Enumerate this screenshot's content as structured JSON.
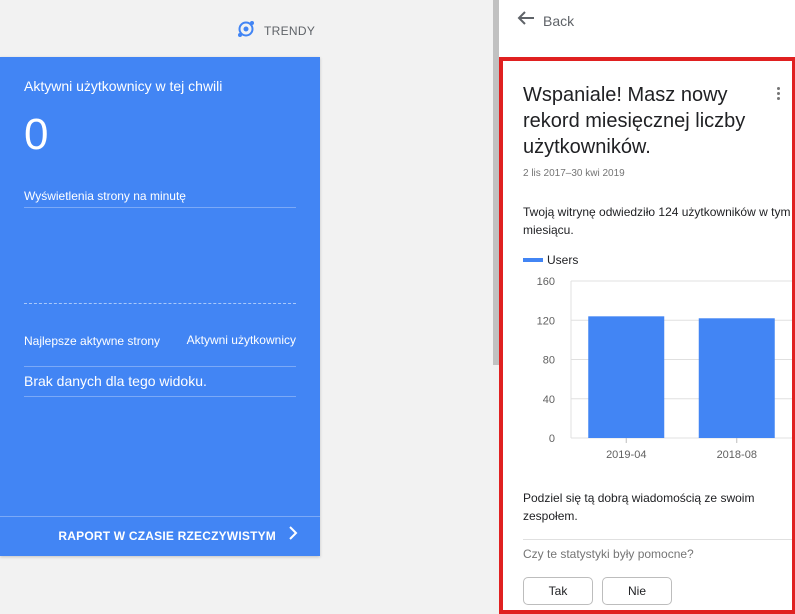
{
  "left_pane": {
    "trendy_label": "TRENDY",
    "realtime_card": {
      "title": "Aktywni użytkownicy w tej chwili",
      "count": "0",
      "pageviews_label": "Wyświetlenia strony na minutę",
      "top_pages_label": "Najlepsze aktywne strony",
      "active_users_label": "Aktywni użytkownicy",
      "no_data": "Brak danych dla tego widoku.",
      "footer_link": "RAPORT W CZASIE RZECZYWISTYM"
    }
  },
  "insights_panel": {
    "back_label": "Back",
    "card": {
      "headline": "Wspaniale! Masz nowy rekord miesięcznej liczby użytkowników.",
      "date_range": "2 lis 2017–30 kwi 2019",
      "message": "Twoją witrynę odwiedziło 124 użytkowników w tym miesiącu.",
      "share_text": "Podziel się tą dobrą wiadomością ze swoim zespołem.",
      "feedback_question": "Czy te statystyki były pomocne?",
      "yes_button": "Tak",
      "no_button": "Nie"
    }
  },
  "chart_data": {
    "type": "bar",
    "categories": [
      "2019-04",
      "2018-08"
    ],
    "series": [
      {
        "name": "Users",
        "values": [
          124,
          122
        ]
      }
    ],
    "ylim": [
      0,
      160
    ],
    "yticks": [
      0,
      40,
      80,
      120,
      160
    ],
    "grid": true,
    "legend": "top-left",
    "color": "#4285f4"
  },
  "colors": {
    "accent": "#4285f4",
    "highlight_border": "#e02020"
  }
}
